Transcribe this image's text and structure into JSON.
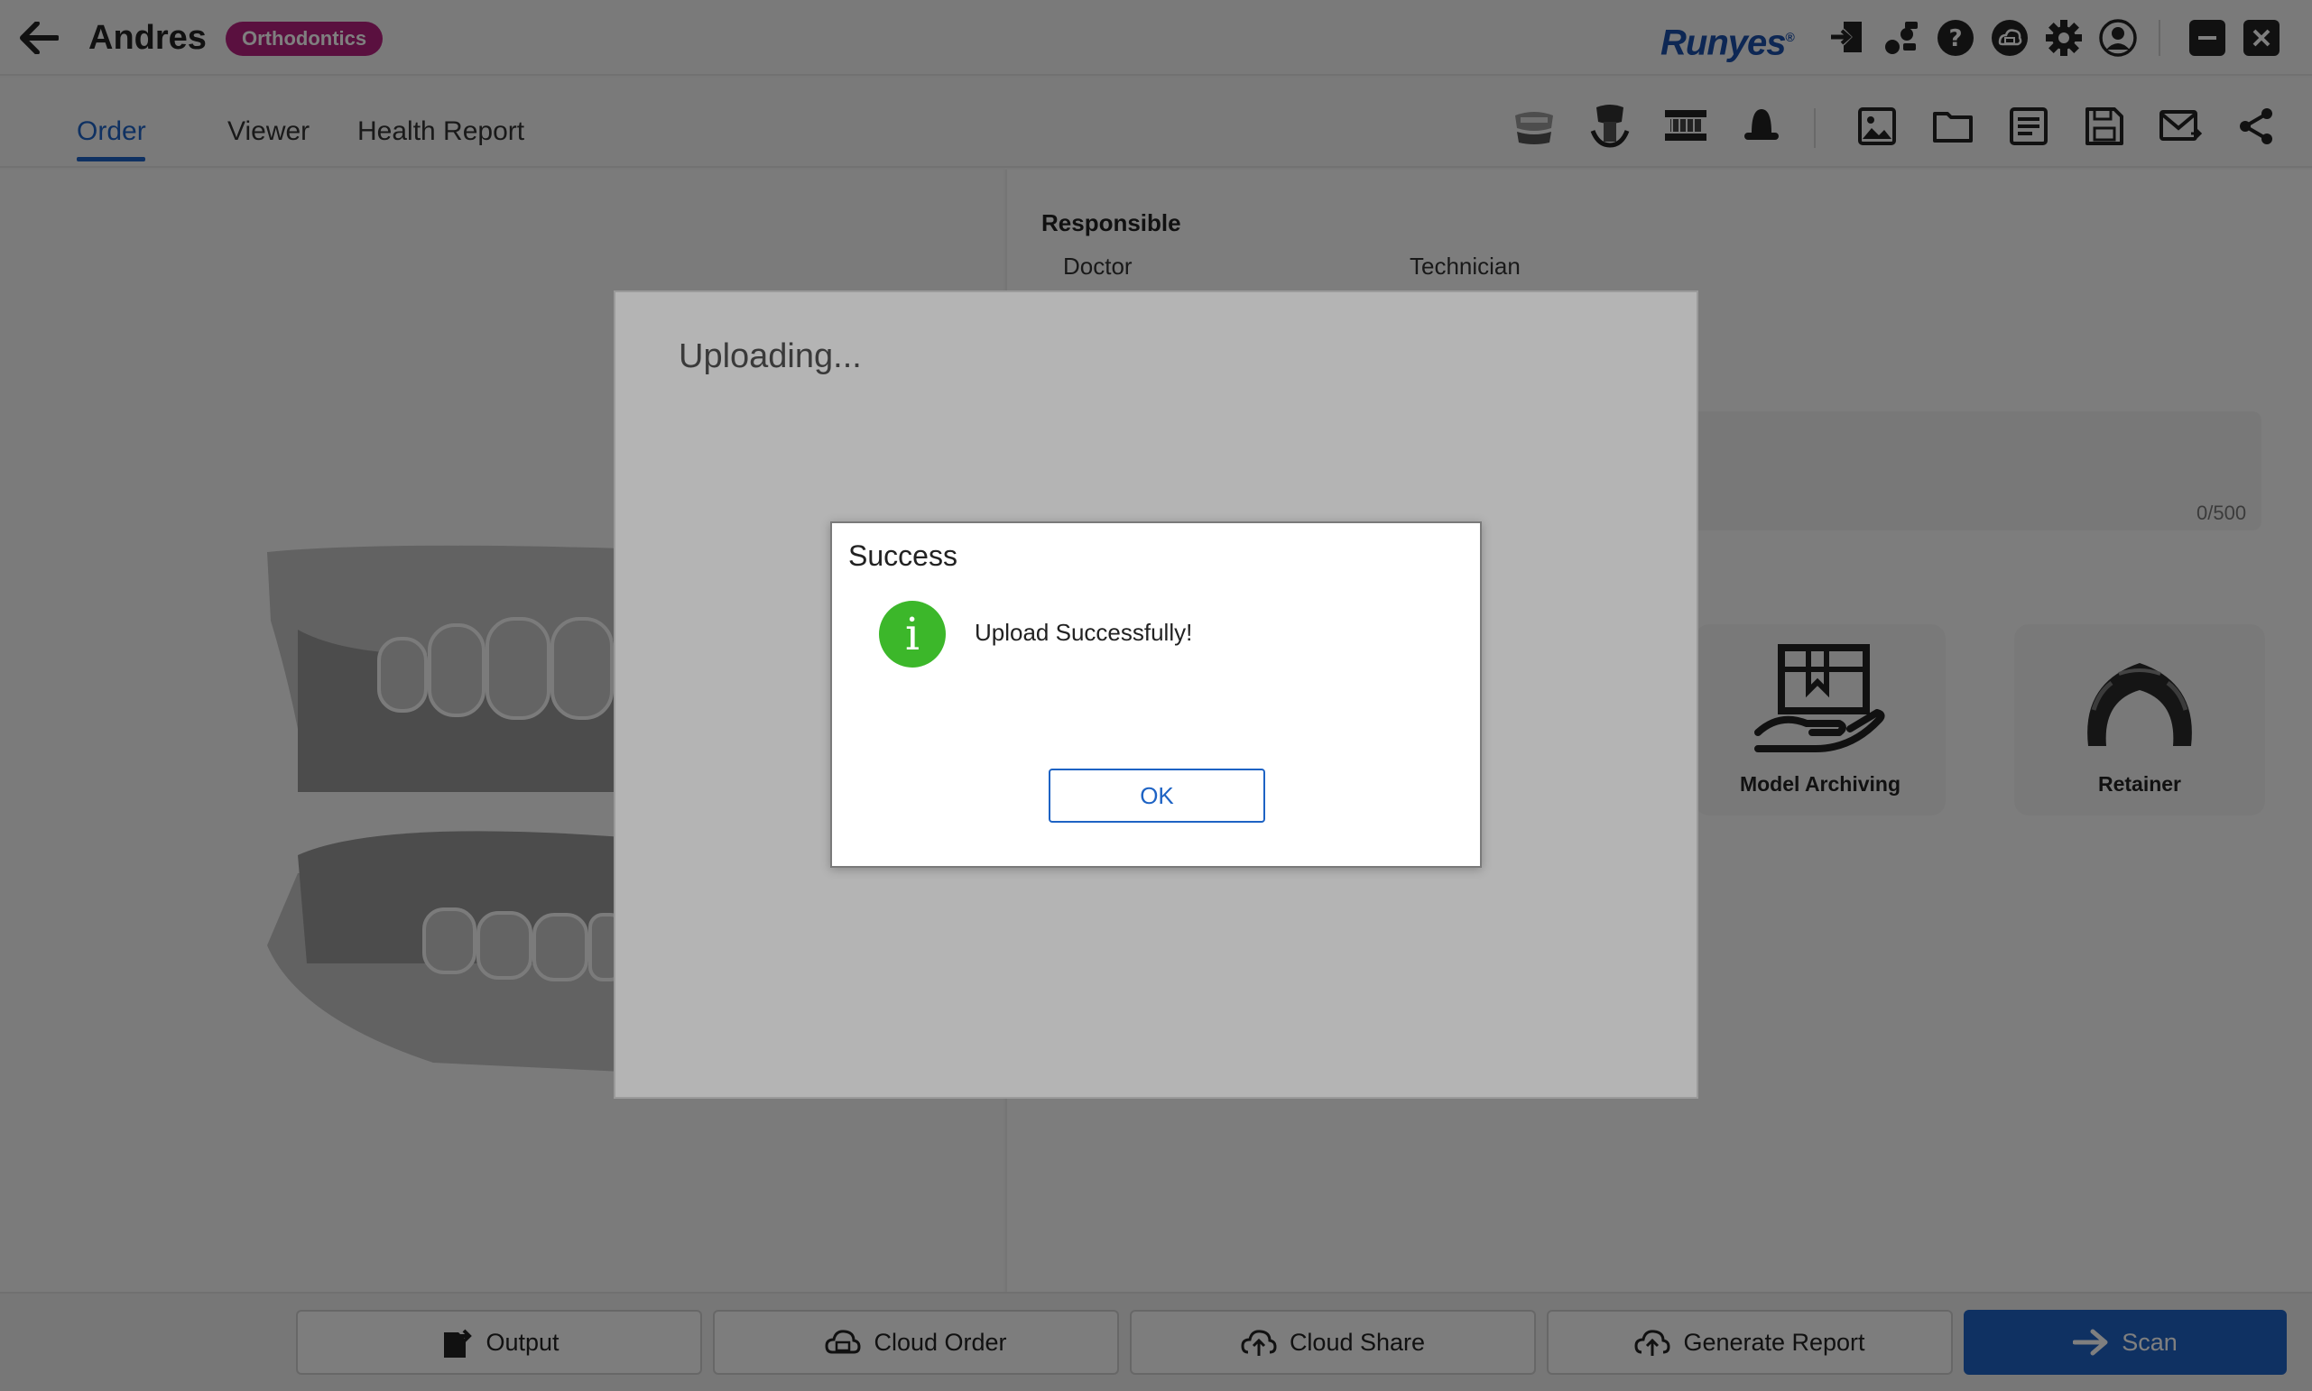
{
  "titlebar": {
    "patient_name": "Andres",
    "case_type": "Orthodontics",
    "case_type_color": "#b4207e",
    "brand": "Runyes",
    "icons": [
      "import-icon",
      "workflow-icon",
      "help-icon",
      "cloud-order-icon",
      "settings-icon",
      "account-icon",
      "minimize-icon",
      "close-icon"
    ]
  },
  "tabs": {
    "items": [
      {
        "label": "Order",
        "active": true
      },
      {
        "label": "Viewer",
        "active": false
      },
      {
        "label": "Health Report",
        "active": false
      }
    ],
    "accent": "#1e63c4",
    "tools": [
      "jaw-model-icon",
      "implant-icon",
      "arch-icon",
      "bell-crown-icon",
      "image-icon",
      "folder-icon",
      "list-icon",
      "save-icon",
      "mail-icon",
      "share-icon"
    ]
  },
  "order": {
    "responsible_title": "Responsible",
    "doctor_label": "Doctor",
    "technician_label": "Technician",
    "notes_counter": "0/500",
    "cards": [
      {
        "label": "Model Archiving",
        "icon": "model-archiving-icon"
      },
      {
        "label": "Retainer",
        "icon": "retainer-icon"
      }
    ]
  },
  "bottombar": {
    "output_label": "Output",
    "cloud_order_label": "Cloud Order",
    "cloud_share_label": "Cloud Share",
    "generate_report_label": "Generate Report",
    "scan_label": "Scan"
  },
  "upload_dialog": {
    "title": "Uploading..."
  },
  "success_dialog": {
    "title": "Success",
    "message": "Upload Successfully!",
    "ok_label": "OK",
    "icon_color": "#3cb72a"
  }
}
